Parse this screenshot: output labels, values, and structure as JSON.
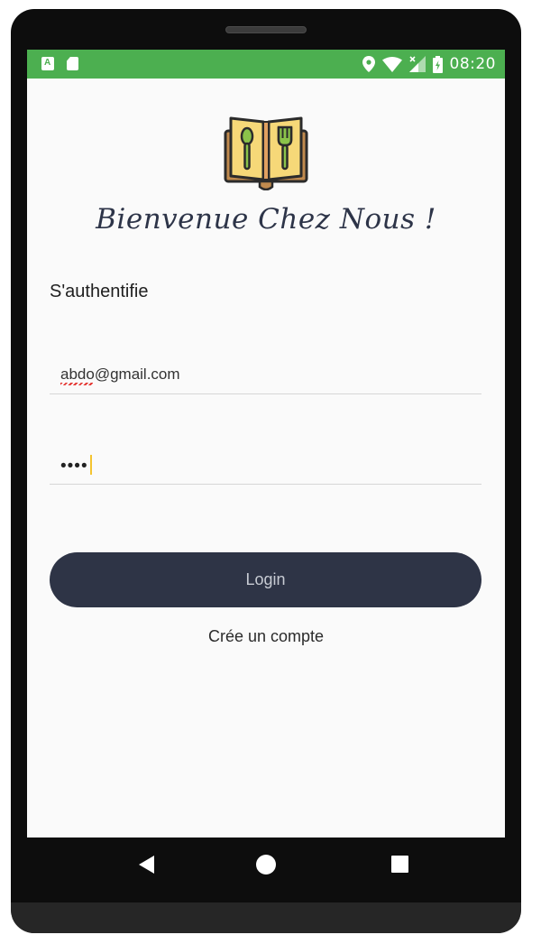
{
  "status_bar": {
    "time": "08:20",
    "left_icons": [
      "a-notification-icon",
      "sd-card-icon"
    ],
    "right_icons": [
      "location-icon",
      "wifi-icon",
      "signal-icon",
      "battery-icon"
    ],
    "color": "#4caf50"
  },
  "app": {
    "logo_icon": "recipe-book-icon",
    "welcome_text": "Bienvenue Chez Nous !",
    "section_title": "S'authentifie"
  },
  "form": {
    "email_value": "abdo@gmail.com",
    "password_mask": "••••"
  },
  "actions": {
    "login_label": "Login",
    "create_account_label": "Crée un compte",
    "button_color": "#2e3446"
  },
  "nav": {
    "icons": [
      "back-icon",
      "home-icon",
      "recents-icon"
    ]
  }
}
